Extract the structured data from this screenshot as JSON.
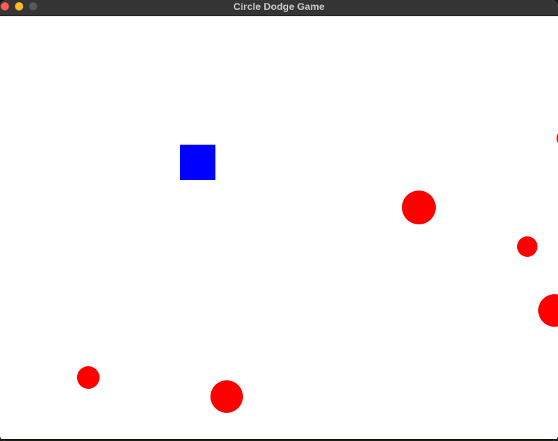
{
  "window": {
    "title": "Circle Dodge Game"
  },
  "colors": {
    "player": "#0000ff",
    "enemy": "#ff0000",
    "background": "#ffffff",
    "titlebar": "#353535"
  },
  "game": {
    "player_shape": "square",
    "enemy_shape": "circle",
    "enemy_count": 6
  }
}
